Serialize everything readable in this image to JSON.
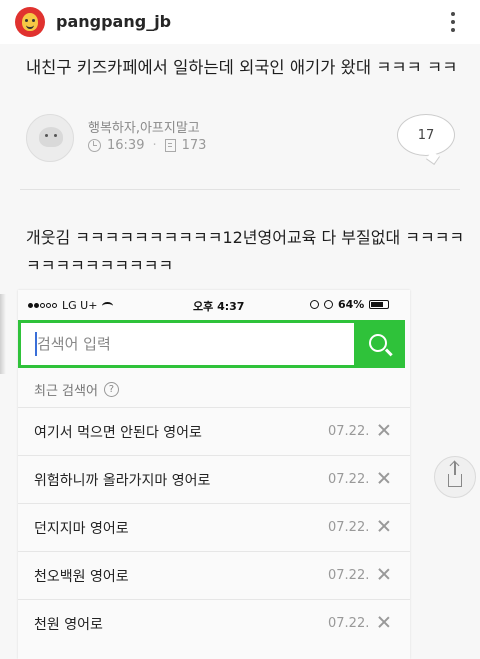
{
  "instagram": {
    "username": "pangpang_jb",
    "avatar_icon": "simpsons-avatar-icon",
    "more_icon": "more-vertical-icon"
  },
  "post": {
    "title": "내친구 키즈카페에서 일하는데 외국인 애기가 왔대 ㅋㅋㅋ ㅋㅋ",
    "author": "행복하자,아프지말고",
    "time": "16:39",
    "views": "173",
    "comment_count": "17",
    "reply": "개웃김 ㅋㅋㅋㅋㅋㅋㅋㅋㅋㅋ12년영어교육 다 부질없대 ㅋㅋㅋㅋ ㅋㅋㅋㅋㅋㅋㅋㅋㅋㅋ"
  },
  "phone": {
    "status": {
      "carrier": "LG U+",
      "time": "오후 4:37",
      "battery": "64%"
    },
    "search": {
      "placeholder": "검색어 입력",
      "accent_color": "#2fc23a"
    },
    "recent_label": "최근 검색어",
    "help_glyph": "?",
    "recent_searches": [
      {
        "term": "여기서 먹으면 안된다 영어로",
        "date": "07.22."
      },
      {
        "term": "위험하니까 올라가지마 영어로",
        "date": "07.22."
      },
      {
        "term": "던지지마 영어로",
        "date": "07.22."
      },
      {
        "term": "천오백원 영어로",
        "date": "07.22."
      },
      {
        "term": "천원 영어로",
        "date": "07.22."
      }
    ]
  }
}
